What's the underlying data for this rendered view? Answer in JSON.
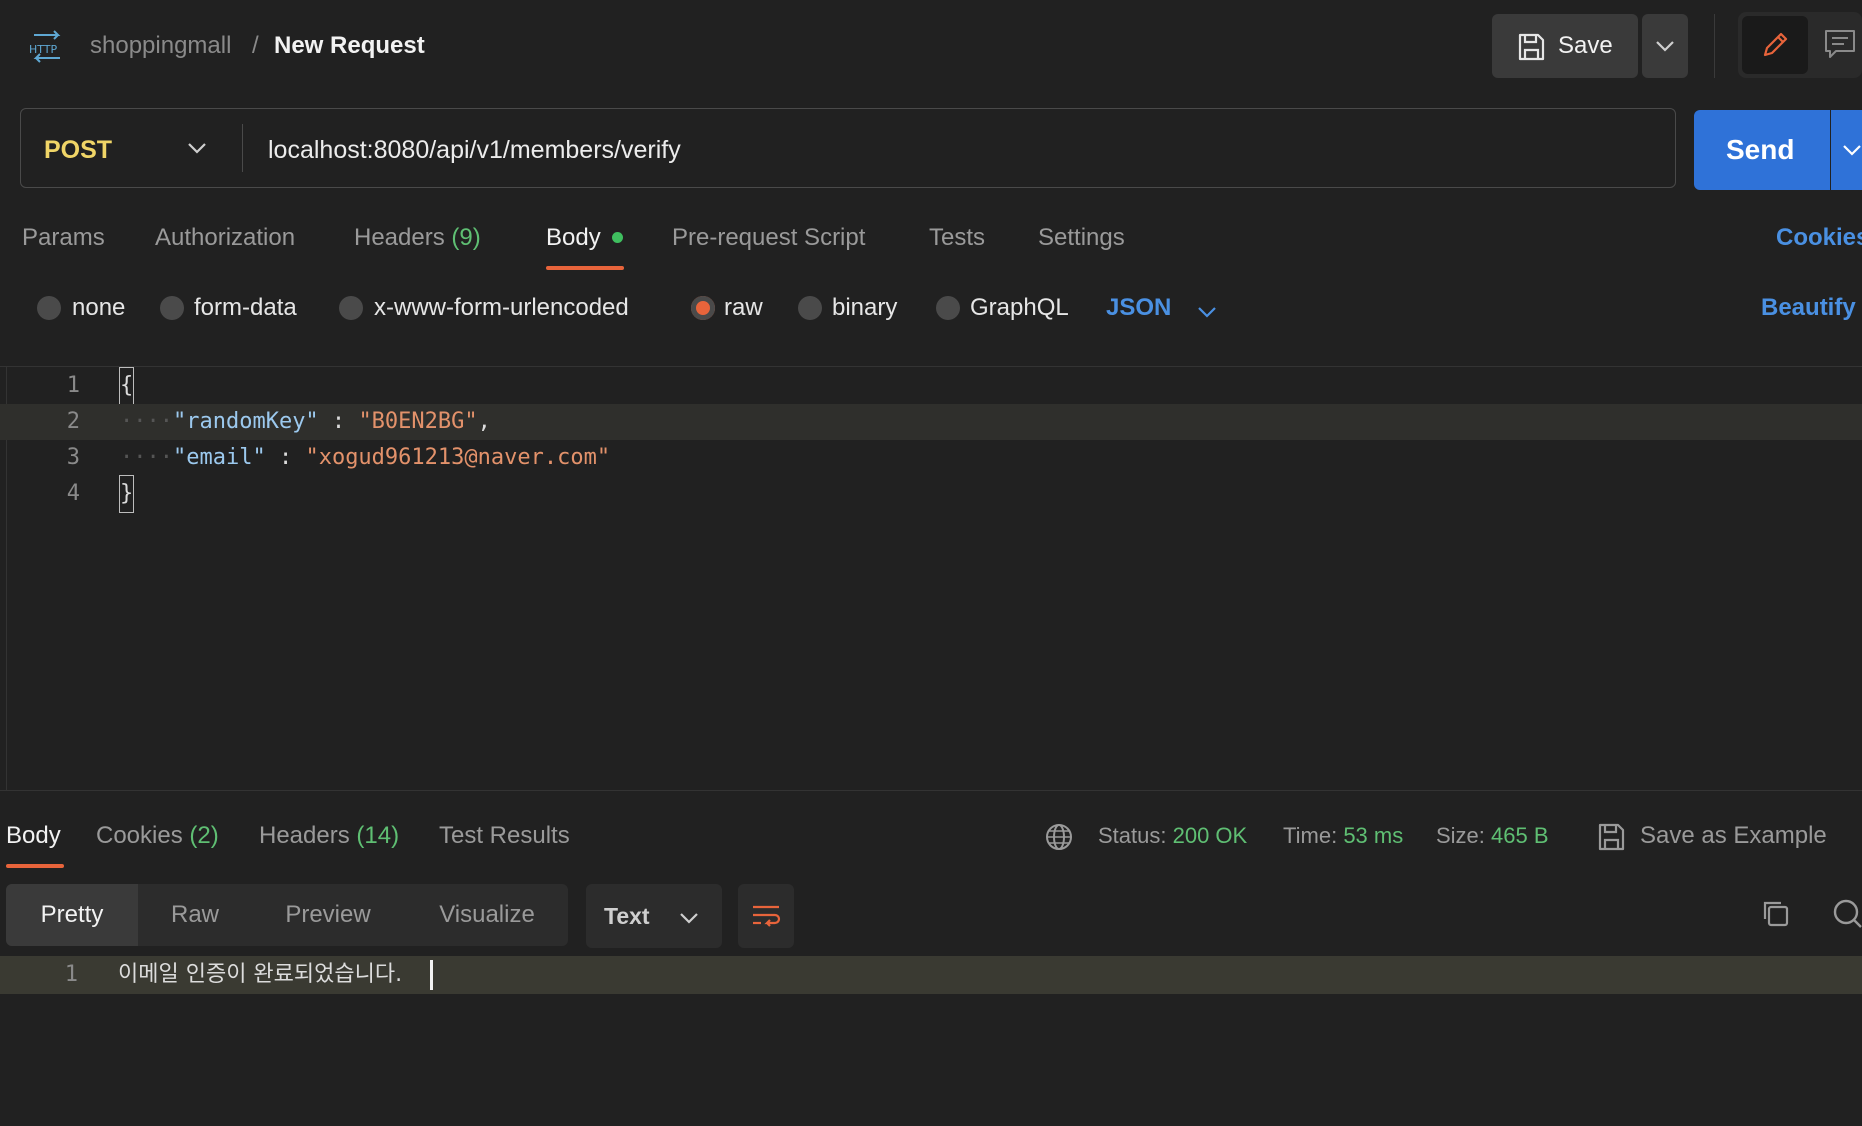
{
  "header": {
    "collection": "shoppingmall",
    "separator": "/",
    "title": "New Request",
    "save_label": "Save"
  },
  "request": {
    "method": "POST",
    "url": "localhost:8080/api/v1/members/verify",
    "send_label": "Send"
  },
  "tabs": {
    "params": "Params",
    "authorization": "Authorization",
    "headers": "Headers",
    "headers_count": "(9)",
    "body": "Body",
    "prerequest": "Pre-request Script",
    "tests": "Tests",
    "settings": "Settings",
    "cookies": "Cookies"
  },
  "body_types": {
    "none": "none",
    "form_data": "form-data",
    "urlencoded": "x-www-form-urlencoded",
    "raw": "raw",
    "binary": "binary",
    "graphql": "GraphQL",
    "selected": "raw",
    "language": "JSON",
    "beautify": "Beautify"
  },
  "editor": {
    "lines": [
      {
        "num": "1",
        "open": "{"
      },
      {
        "num": "2",
        "key": "\"randomKey\"",
        "sep": " : ",
        "value": "\"B0EN2BG\"",
        "tail": ","
      },
      {
        "num": "3",
        "key": "\"email\"",
        "sep": " : ",
        "value": "\"xogud961213@naver.com\"",
        "tail": ""
      },
      {
        "num": "4",
        "close": "}"
      }
    ]
  },
  "response": {
    "tabs": {
      "body": "Body",
      "cookies": "Cookies",
      "cookies_count": "(2)",
      "headers": "Headers",
      "headers_count": "(14)",
      "test_results": "Test Results"
    },
    "status_label": "Status:",
    "status_value": "200 OK",
    "time_label": "Time:",
    "time_value": "53 ms",
    "size_label": "Size:",
    "size_value": "465 B",
    "save_example": "Save as Example",
    "views": {
      "pretty": "Pretty",
      "raw": "Raw",
      "preview": "Preview",
      "visualize": "Visualize"
    },
    "format": "Text",
    "line_num": "1",
    "body_text": "이메일 인증이 완료되었습니다."
  },
  "colors": {
    "accent_orange": "#e8643b",
    "send_blue": "#2f72d8",
    "link_blue": "#4a90e2",
    "status_green": "#5fbf73",
    "method_yellow": "#f0d567"
  },
  "icons": {
    "request_type": "http-icon",
    "save": "floppy-disk-icon",
    "edit": "pencil-icon",
    "comments": "comment-icon",
    "network": "globe-icon",
    "copy": "copy-icon",
    "search": "search-icon",
    "wrap": "wrap-lines-icon"
  }
}
